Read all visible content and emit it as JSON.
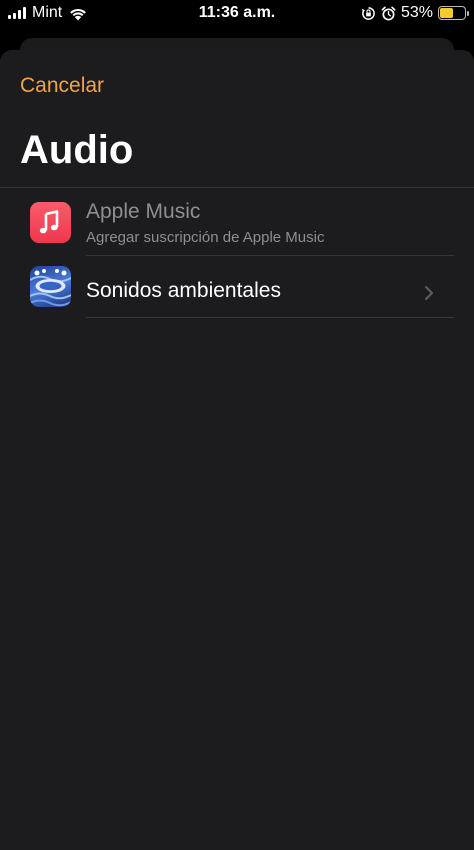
{
  "status_bar": {
    "carrier": "Mint",
    "time": "11:36 a.m.",
    "battery_percent": "53%",
    "battery_level": 0.53,
    "icons": [
      "signal-icon",
      "wifi-icon",
      "orientation-lock-icon",
      "alarm-icon",
      "battery-icon"
    ]
  },
  "sheet": {
    "cancel_label": "Cancelar",
    "title": "Audio"
  },
  "rows": [
    {
      "title": "Apple Music",
      "subtitle": "Agregar suscripción de Apple Music",
      "icon": "music-note-icon",
      "enabled": false
    },
    {
      "title": "Sonidos ambientales",
      "icon": "ambient-sounds-app-icon",
      "has_chevron": true
    }
  ],
  "colors": {
    "accent": "#f0a34a",
    "sheet_background": "#1c1c1e",
    "secondary_text": "#8e8e93",
    "battery_fill": "#f4cb2f",
    "apple_music_red": "#f0364d"
  }
}
